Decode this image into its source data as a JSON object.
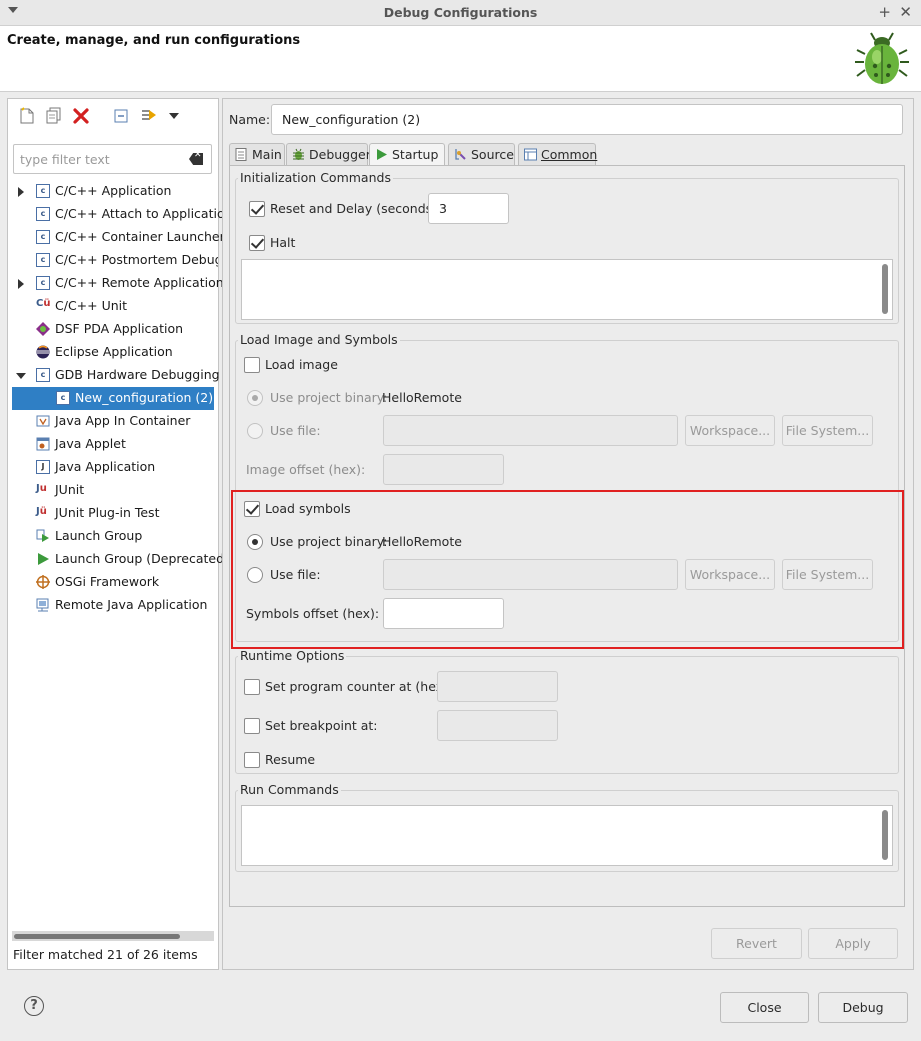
{
  "window": {
    "title": "Debug Configurations"
  },
  "header": {
    "title": "Create, manage, and run configurations"
  },
  "left": {
    "filter_placeholder": "type filter text",
    "tree": [
      {
        "label": "C/C++ Application",
        "expandable": true,
        "expanded": false
      },
      {
        "label": "C/C++ Attach to Application"
      },
      {
        "label": "C/C++ Container Launcher"
      },
      {
        "label": "C/C++ Postmortem Debugger"
      },
      {
        "label": "C/C++ Remote Application",
        "expandable": true,
        "expanded": false
      },
      {
        "label": "C/C++ Unit"
      },
      {
        "label": "DSF PDA Application"
      },
      {
        "label": "Eclipse Application"
      },
      {
        "label": "GDB Hardware Debugging",
        "expandable": true,
        "expanded": true
      },
      {
        "label": "New_configuration (2)",
        "selected": true,
        "child": true
      },
      {
        "label": "Java App In Container"
      },
      {
        "label": "Java Applet"
      },
      {
        "label": "Java Application"
      },
      {
        "label": "JUnit"
      },
      {
        "label": "JUnit Plug-in Test"
      },
      {
        "label": "Launch Group"
      },
      {
        "label": "Launch Group (Deprecated)"
      },
      {
        "label": "OSGi Framework"
      },
      {
        "label": "Remote Java Application"
      }
    ],
    "filter_status": "Filter matched 21 of 26 items"
  },
  "right": {
    "name_label": "Name:",
    "name_value": "New_configuration (2)",
    "tabs": [
      {
        "label": "Main",
        "icon": "main-tab-icon"
      },
      {
        "label": "Debugger",
        "icon": "debugger-bug-icon"
      },
      {
        "label": "Startup",
        "icon": "run-arrow-icon",
        "active": true
      },
      {
        "label": "Source",
        "icon": "source-icon"
      },
      {
        "label": "Common",
        "icon": "common-icon"
      }
    ],
    "init": {
      "title": "Initialization Commands",
      "reset_label": "Reset and Delay (seconds):",
      "reset_checked": true,
      "delay_value": "3",
      "halt_label": "Halt",
      "halt_checked": true
    },
    "load": {
      "title": "Load Image and Symbols",
      "load_image_label": "Load image",
      "load_image_checked": false,
      "use_project_binary_label": "Use project binary:",
      "project_binary": "HelloRemote",
      "use_file_label": "Use file:",
      "workspace_label": "Workspace...",
      "filesystem_label": "File System...",
      "image_offset_label": "Image offset (hex):",
      "load_symbols_label": "Load symbols",
      "load_symbols_checked": true,
      "symbols_project_binary": "HelloRemote",
      "symbols_offset_label": "Symbols offset (hex):"
    },
    "runtime": {
      "title": "Runtime Options",
      "set_pc_label": "Set program counter at (hex):",
      "set_bp_label": "Set breakpoint at:",
      "resume_label": "Resume"
    },
    "run_commands_title": "Run Commands",
    "revert_label": "Revert",
    "apply_label": "Apply"
  },
  "footer": {
    "close_label": "Close",
    "debug_label": "Debug",
    "help_label": "?"
  }
}
